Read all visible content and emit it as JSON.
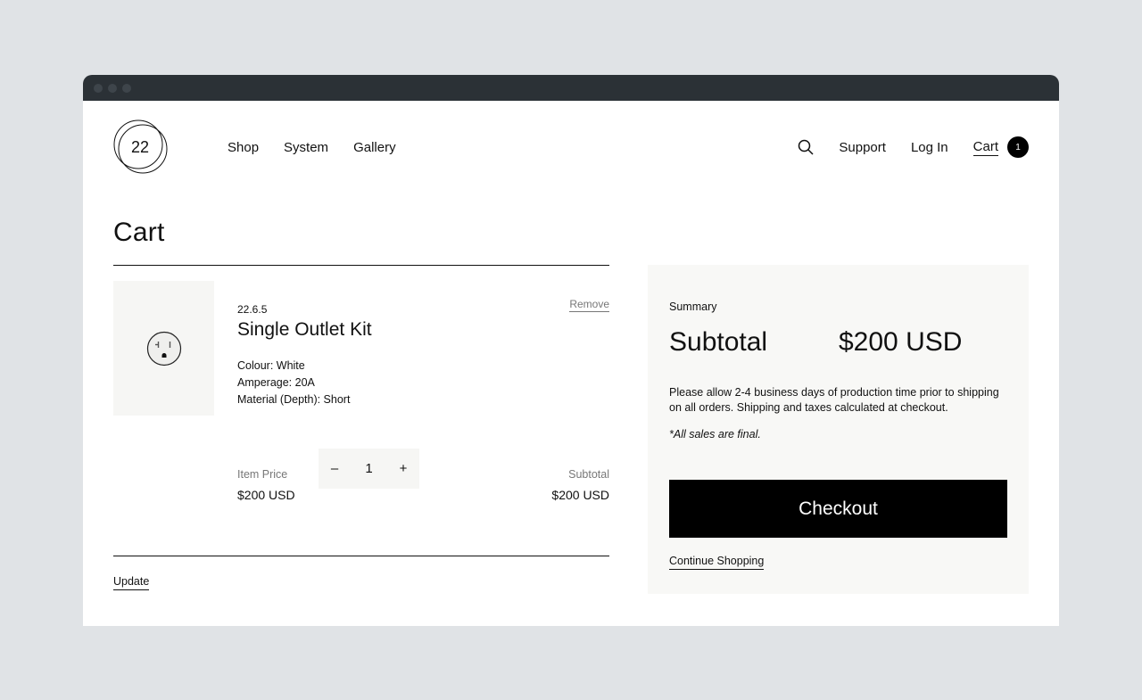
{
  "header": {
    "logo_text": "22",
    "nav": [
      "Shop",
      "System",
      "Gallery"
    ],
    "support": "Support",
    "login": "Log In",
    "cart": "Cart",
    "cart_count": "1"
  },
  "page": {
    "title": "Cart"
  },
  "item": {
    "sku": "22.6.5",
    "name": "Single Outlet Kit",
    "remove": "Remove",
    "options": [
      "Colour: White",
      "Amperage: 20A",
      "Material (Depth): Short"
    ],
    "item_price_label": "Item Price",
    "item_price": "$200 USD",
    "quantity": "1",
    "decrement": "–",
    "increment": "+",
    "subtotal_label": "Subtotal",
    "subtotal": "$200 USD"
  },
  "update": "Update",
  "summary": {
    "label": "Summary",
    "subtotal_label": "Subtotal",
    "subtotal": "$200 USD",
    "note": "Please allow 2-4 business days of production time prior to shipping on all orders. Shipping and taxes calculated at checkout.",
    "final": "*All sales are final.",
    "checkout": "Checkout",
    "continue": "Continue Shopping"
  }
}
